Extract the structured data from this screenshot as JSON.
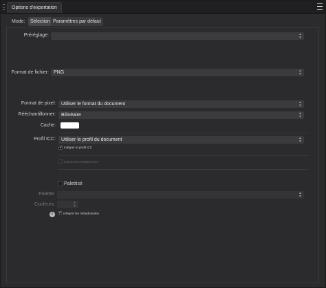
{
  "titlebar": {
    "tab_title": "Options d'exportation"
  },
  "mode": {
    "label": "Mode:",
    "options": [
      "Sélection",
      "Paramètres par défaut"
    ],
    "selected": "Sélection"
  },
  "preset": {
    "label": "Préréglage:",
    "value": ""
  },
  "file_format": {
    "label": "Format de fichier:",
    "value": "PNG"
  },
  "pixel_format": {
    "label": "Format de pixel:",
    "value": "Utiliser le format du document"
  },
  "resample": {
    "label": "Rééchantillonner:",
    "value": "Bilinéaire"
  },
  "matte": {
    "label": "Cache:",
    "color": "#ffffff"
  },
  "icc": {
    "label": "Profil ICC:",
    "value": "Utiliser le profil du document",
    "embed_label": "Intégrer le profil ICC",
    "embed_checked": true
  },
  "metadata": {
    "label": "Inclure les métadonnées",
    "checked": false
  },
  "palettized": {
    "label": "Palettisé",
    "checked": false
  },
  "palette": {
    "label": "Palette:",
    "value": ""
  },
  "colors": {
    "label": "Couleurs:",
    "value": ""
  },
  "embed_metadata": {
    "label": "Intégrer les métadonnées",
    "checked": true
  },
  "icons": {
    "menu": "hamburger-menu-icon",
    "info": "info-icon",
    "chevron": "up-down-chevron-icon"
  }
}
